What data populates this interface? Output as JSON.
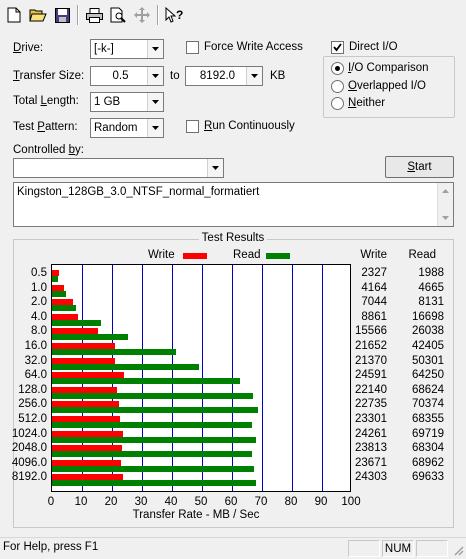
{
  "toolbar": {
    "buttons": [
      "new-icon",
      "open-icon",
      "save-icon",
      "print-icon",
      "print-preview-icon",
      "move-icon",
      "context-help-icon"
    ]
  },
  "form": {
    "drive_label": "Drive:",
    "drive_value": "[-k-]",
    "transfer_size_label": "Transfer Size:",
    "transfer_from": "0.5",
    "transfer_to_label": "to",
    "transfer_to": "8192.0",
    "transfer_unit": "KB",
    "total_length_label": "Total Length:",
    "total_length_value": "1 GB",
    "test_pattern_label": "Test Pattern:",
    "test_pattern_value": "Random",
    "controlled_by_label": "Controlled by:",
    "controlled_by_value": "",
    "force_write_access_label": "Force Write Access",
    "force_write_access_checked": false,
    "run_continuously_label": "Run Continuously",
    "run_continuously_checked": false,
    "direct_io_label": "Direct I/O",
    "direct_io_checked": true,
    "radio_options": [
      "I/O Comparison",
      "Overlapped I/O",
      "Neither"
    ],
    "radio_selected": 0,
    "start_label": "Start",
    "description": "Kingston_128GB_3.0_NTSF_normal_formatiert"
  },
  "results": {
    "title": "Test Results",
    "legend_write": "Write",
    "legend_read": "Read",
    "col_write": "Write",
    "col_read": "Read",
    "colors": {
      "write": "#ff0000",
      "read": "#008000",
      "grid": "#0000c0"
    }
  },
  "chart_data": {
    "type": "bar",
    "orientation": "horizontal",
    "xlabel": "Transfer Rate - MB / Sec",
    "xlim": [
      0,
      100
    ],
    "xticks": [
      "0",
      "10",
      "20",
      "30",
      "40",
      "50",
      "60",
      "70",
      "80",
      "90",
      "100"
    ],
    "categories": [
      "0.5",
      "1.0",
      "2.0",
      "4.0",
      "8.0",
      "16.0",
      "32.0",
      "64.0",
      "128.0",
      "256.0",
      "512.0",
      "1024.0",
      "2048.0",
      "4096.0",
      "8192.0"
    ],
    "series": [
      {
        "name": "Write",
        "values": [
          2327,
          4164,
          7044,
          8861,
          15566,
          21652,
          21370,
          24591,
          22140,
          22735,
          23301,
          24261,
          23813,
          23671,
          24303
        ]
      },
      {
        "name": "Read",
        "values": [
          1988,
          4665,
          8131,
          16698,
          26038,
          42405,
          50301,
          64250,
          68624,
          70374,
          68355,
          69719,
          68304,
          68962,
          69633
        ]
      }
    ]
  },
  "status": {
    "help_text": "For Help, press F1",
    "num_indicator": "NUM"
  }
}
